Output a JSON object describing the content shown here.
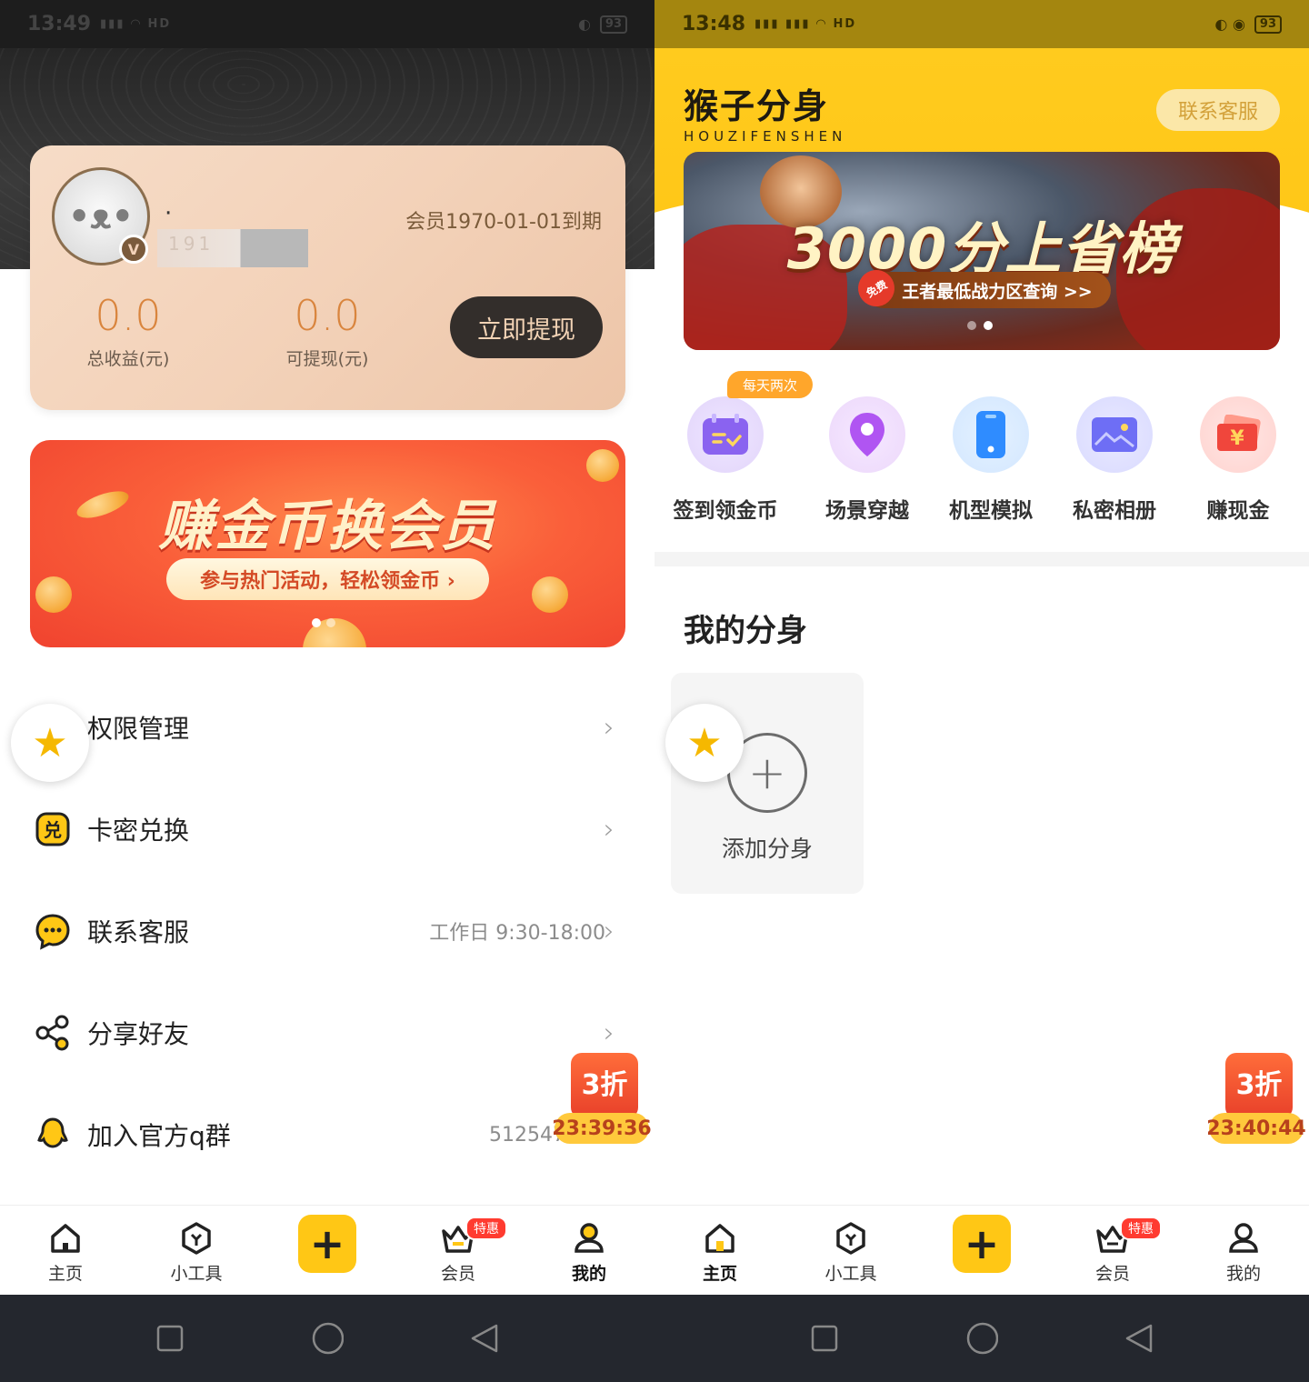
{
  "left": {
    "status": {
      "time": "13:49",
      "signal": "HD",
      "battery": "93"
    },
    "profile": {
      "name": "·",
      "phone_masked": "191",
      "expire_text": "会员1970-01-01到期",
      "total_value": "0.0",
      "total_label": "总收益(元)",
      "withdrawable_value": "0.0",
      "withdrawable_label": "可提现(元)",
      "withdraw_button": "立即提现"
    },
    "promo": {
      "title": "赚金币换会员",
      "subtitle": "参与热门活动，轻松领金币 ›"
    },
    "menu": [
      {
        "label": "权限管理",
        "value": ""
      },
      {
        "label": "卡密兑换",
        "value": ""
      },
      {
        "label": "联系客服",
        "value": "工作日 9:30-18:00"
      },
      {
        "label": "分享好友",
        "value": ""
      },
      {
        "label": "加入官方q群",
        "value": "512547"
      }
    ],
    "discount": {
      "label": "3折",
      "timer": "23:39:36"
    },
    "tabs": [
      {
        "label": "主页",
        "icon": "home-icon"
      },
      {
        "label": "小工具",
        "icon": "tools-icon"
      },
      {
        "label": "",
        "icon": "plus-icon"
      },
      {
        "label": "会员",
        "icon": "crown-basket-icon",
        "badge": "特惠"
      },
      {
        "label": "我的",
        "icon": "user-icon"
      }
    ],
    "active_tab": "我的"
  },
  "right": {
    "status": {
      "time": "13:48",
      "signal": "HD",
      "battery": "93"
    },
    "brand": {
      "name_cn": "猴子分身",
      "name_en": "HOUZIFENSHEN"
    },
    "contact_button": "联系客服",
    "banner": {
      "title": "3000分上省榜",
      "subtitle": "王者最低战力区查询 >>",
      "free_tag": "免费"
    },
    "features": [
      {
        "label": "签到领金币",
        "tag": "每天两次",
        "icon": "calendar-check-icon",
        "color": "#8a63f0"
      },
      {
        "label": "场景穿越",
        "icon": "location-pin-icon",
        "color": "#b055f2"
      },
      {
        "label": "机型模拟",
        "icon": "phone-icon",
        "color": "#2f8cff"
      },
      {
        "label": "私密相册",
        "icon": "photo-album-icon",
        "color": "#6e6ef5"
      },
      {
        "label": "赚现金",
        "icon": "cash-icon",
        "color": "#f0463c"
      }
    ],
    "section_title": "我的分身",
    "add_clone_label": "添加分身",
    "discount": {
      "label": "3折",
      "timer": "23:40:44"
    },
    "tabs": [
      {
        "label": "主页",
        "icon": "home-icon"
      },
      {
        "label": "小工具",
        "icon": "tools-icon"
      },
      {
        "label": "",
        "icon": "plus-icon"
      },
      {
        "label": "会员",
        "icon": "crown-basket-icon",
        "badge": "特惠"
      },
      {
        "label": "我的",
        "icon": "user-icon"
      }
    ],
    "active_tab": "主页"
  },
  "colors": {
    "accent_yellow": "#ffc715",
    "promo_red": "#f0432f",
    "gold_text": "#d9853e",
    "nav_dark": "#24272e"
  }
}
